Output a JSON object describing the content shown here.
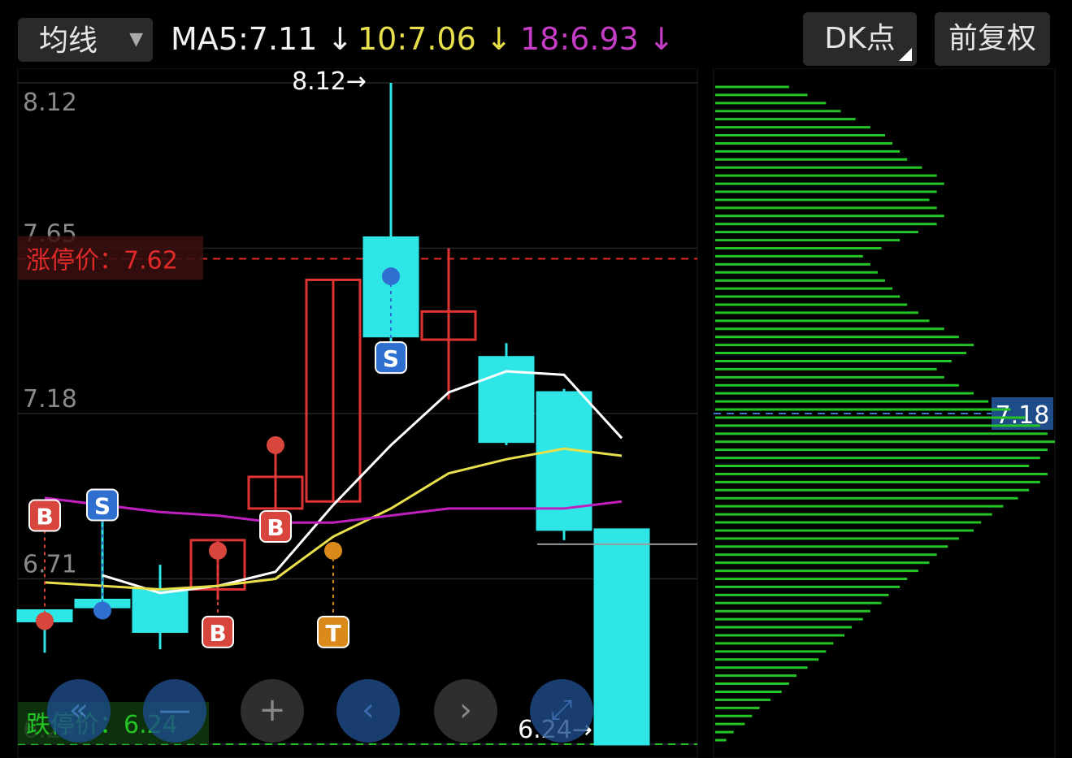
{
  "toolbar": {
    "indicator_label": "均线",
    "ma5_label": "MA5:7.11",
    "ma10_label": "10:7.06",
    "ma18_label": "18:6.93",
    "dk_label": "DK点",
    "adjust_label": "前复权"
  },
  "colors": {
    "up": "#e03434",
    "down": "#2ee6e6",
    "ma5": "#ffffff",
    "ma10": "#e8e04a",
    "ma18": "#c020c0",
    "volume_profile": "#25c425"
  },
  "chart_data": {
    "type": "candlestick",
    "ylim": [
      6.24,
      8.12
    ],
    "y_ticks": [
      8.12,
      7.65,
      7.18,
      6.71,
      6.24
    ],
    "limit_up": {
      "label": "涨停价：7.62",
      "value": 7.62
    },
    "limit_down": {
      "label": "跌停价：6.24",
      "value": 6.24
    },
    "max_annotation": {
      "label": "8.12→",
      "value": 8.12
    },
    "min_annotation": {
      "label": "6.24→",
      "value": 6.24
    },
    "current_price": {
      "label": "7.18",
      "value": 7.18
    },
    "candles": [
      {
        "open": 6.62,
        "close": 6.59,
        "high": 6.62,
        "low": 6.5
      },
      {
        "open": 6.65,
        "close": 6.63,
        "high": 6.93,
        "low": 6.62
      },
      {
        "open": 6.68,
        "close": 6.56,
        "high": 6.75,
        "low": 6.51
      },
      {
        "open": 6.68,
        "close": 6.82,
        "high": 6.82,
        "low": 6.65
      },
      {
        "open": 6.91,
        "close": 7.0,
        "high": 7.07,
        "low": 6.82
      },
      {
        "open": 6.93,
        "close": 7.56,
        "high": 7.56,
        "low": 6.93
      },
      {
        "open": 7.68,
        "close": 7.4,
        "high": 8.12,
        "low": 7.32
      },
      {
        "open": 7.39,
        "close": 7.47,
        "high": 7.65,
        "low": 7.22
      },
      {
        "open": 7.34,
        "close": 7.1,
        "high": 7.38,
        "low": 7.09
      },
      {
        "open": 7.24,
        "close": 6.85,
        "high": 7.25,
        "low": 6.82
      },
      {
        "open": 6.85,
        "close": 6.24,
        "high": 6.85,
        "low": 6.24
      }
    ],
    "series": [
      {
        "name": "MA5",
        "values": [
          null,
          6.72,
          6.67,
          6.69,
          6.73,
          6.92,
          7.09,
          7.24,
          7.3,
          7.29,
          7.11
        ]
      },
      {
        "name": "MA10",
        "values": [
          6.7,
          6.69,
          6.68,
          6.69,
          6.71,
          6.83,
          6.91,
          7.01,
          7.05,
          7.08,
          7.06
        ]
      },
      {
        "name": "MA18",
        "values": [
          6.94,
          6.92,
          6.9,
          6.89,
          6.87,
          6.87,
          6.89,
          6.91,
          6.91,
          6.91,
          6.93
        ]
      }
    ],
    "signals": [
      {
        "candle": 0,
        "type": "B",
        "price": 6.59,
        "dot": 6.59,
        "pos": "above"
      },
      {
        "candle": 1,
        "type": "S",
        "price": 6.62,
        "dot": 6.62,
        "pos": "above"
      },
      {
        "candle": 3,
        "type": "B",
        "price": 6.79,
        "dot": 6.79,
        "pos": "below"
      },
      {
        "candle": 4,
        "type": "B",
        "price": 7.09,
        "dot": 7.09,
        "pos": "below"
      },
      {
        "candle": 5,
        "type": "T",
        "price": 6.79,
        "dot": 6.79,
        "pos": "below"
      },
      {
        "candle": 6,
        "type": "S",
        "price": 7.57,
        "dot": 7.57,
        "pos": "below"
      }
    ],
    "volume_profile": {
      "bins": 82,
      "values": [
        3,
        5,
        8,
        10,
        12,
        15,
        18,
        20,
        22,
        25,
        28,
        30,
        32,
        35,
        37,
        40,
        42,
        45,
        47,
        50,
        52,
        55,
        58,
        60,
        63,
        66,
        70,
        72,
        75,
        78,
        82,
        85,
        88,
        90,
        85,
        88,
        90,
        92,
        90,
        88,
        84,
        80,
        74,
        70,
        66,
        62,
        60,
        64,
        68,
        70,
        66,
        62,
        58,
        55,
        52,
        50,
        48,
        46,
        44,
        42,
        40,
        45,
        50,
        55,
        60,
        62,
        60,
        58,
        60,
        62,
        60,
        56,
        52,
        50,
        48,
        46,
        42,
        38,
        34,
        30,
        25,
        20
      ]
    }
  }
}
